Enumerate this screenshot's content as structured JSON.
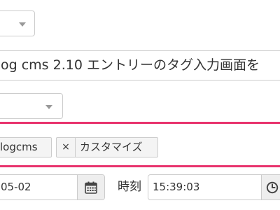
{
  "form": {
    "title_value": "og cms 2.10 エントリーのタグ入力画面を",
    "tags": [
      {
        "remove_label": "×",
        "label": "logcms"
      },
      {
        "remove_label": "×",
        "label": "カスタマイズ"
      }
    ],
    "date_value": "05-02",
    "time_label": "時刻",
    "time_value": "15:39:03"
  },
  "icons": {
    "select_caret": "chevron-down-icon",
    "date_addon": "calendar-icon",
    "time_addon": "clock-icon"
  },
  "colors": {
    "highlight": "#e8336d",
    "border": "#cccccc",
    "addon_bg": "#eeeeee",
    "tag_bg": "#f4f4f4"
  }
}
